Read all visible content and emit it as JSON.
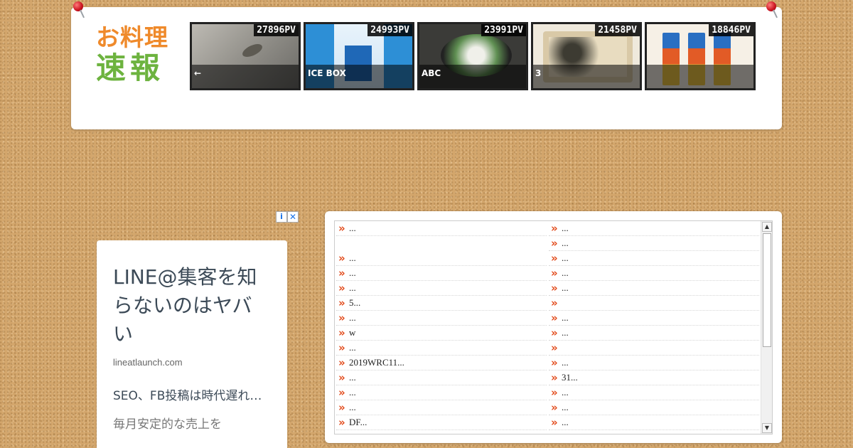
{
  "logo": {
    "line1": "お料理",
    "line2": "速報"
  },
  "thumbnails": [
    {
      "pv": "27896PV",
      "caption": "←"
    },
    {
      "pv": "24993PV",
      "caption": "ICE BOX"
    },
    {
      "pv": "23991PV",
      "caption": "ABC"
    },
    {
      "pv": "21458PV",
      "caption": "3"
    },
    {
      "pv": "18846PV",
      "caption": ""
    }
  ],
  "ad": {
    "choices_info": "i",
    "choices_close": "✕",
    "title": "LINE@集客を知らないのはヤバい",
    "domain": "lineatlaunch.com",
    "body": "SEO、FB投稿は時代遅れ…",
    "sub": "毎月安定的な売上を"
  },
  "links": {
    "left": [
      "...",
      "",
      "...",
      "...",
      "...",
      "5...",
      "...",
      "w",
      "...",
      "2019WRC11...",
      "...",
      "...",
      "...",
      "DF..."
    ],
    "right": [
      "...",
      "...",
      "...",
      "...",
      "...",
      "",
      "...",
      "...",
      "",
      "...",
      "31...",
      "...",
      "...",
      "..."
    ]
  },
  "scroll": {
    "up": "▲",
    "down": "▼"
  },
  "colors": {
    "logo_orange": "#ef8a2b",
    "logo_green": "#6db33f",
    "arrow_red": "#e24a1a",
    "cork": "#d3a66c"
  }
}
